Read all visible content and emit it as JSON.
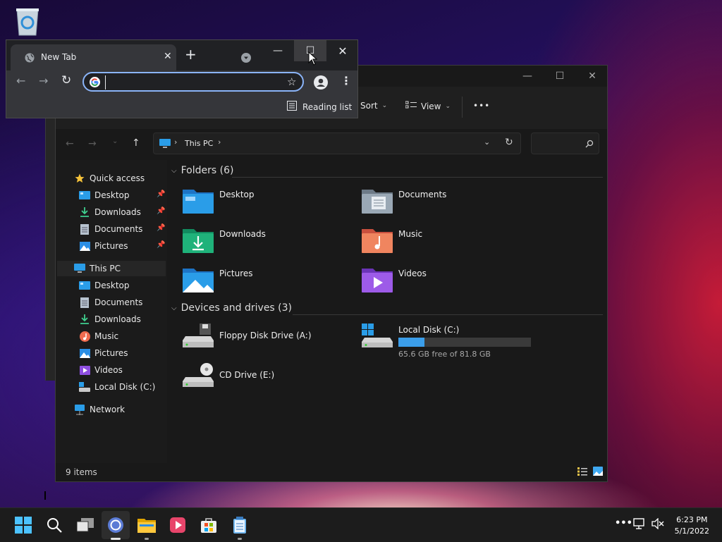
{
  "chrome": {
    "tab_title": "New Tab",
    "tab_close": "✕",
    "new_tab": "+",
    "minimize": "—",
    "maximize": "☐",
    "close": "✕",
    "omnibox_value": "",
    "reading_list": "Reading list"
  },
  "explorer": {
    "toolbar": {
      "sort": "Sort",
      "view": "View",
      "more": "•••"
    },
    "breadcrumb": {
      "location": "This PC"
    },
    "nav": {
      "quick_access": "Quick access",
      "quick_items": [
        "Desktop",
        "Downloads",
        "Documents",
        "Pictures"
      ],
      "this_pc": "This PC",
      "pc_items": [
        "Desktop",
        "Documents",
        "Downloads",
        "Music",
        "Pictures",
        "Videos",
        "Local Disk (C:)"
      ],
      "network": "Network"
    },
    "folders_header": "Folders (6)",
    "folders": [
      "Desktop",
      "Documents",
      "Downloads",
      "Music",
      "Pictures",
      "Videos"
    ],
    "drives_header": "Devices and drives (3)",
    "drives": {
      "floppy": "Floppy Disk Drive (A:)",
      "local": "Local Disk (C:)",
      "local_free": "65.6 GB free of 81.8 GB",
      "local_used_fraction": 0.198,
      "cd": "CD Drive (E:)"
    },
    "status": "9 items"
  },
  "taskbar": {
    "time": "6:23 PM",
    "date": "5/1/2022"
  },
  "colors": {
    "accent": "#8ab4f8",
    "disk_bar": "#3b9eea",
    "folder_blue": "#2a8ee5"
  }
}
